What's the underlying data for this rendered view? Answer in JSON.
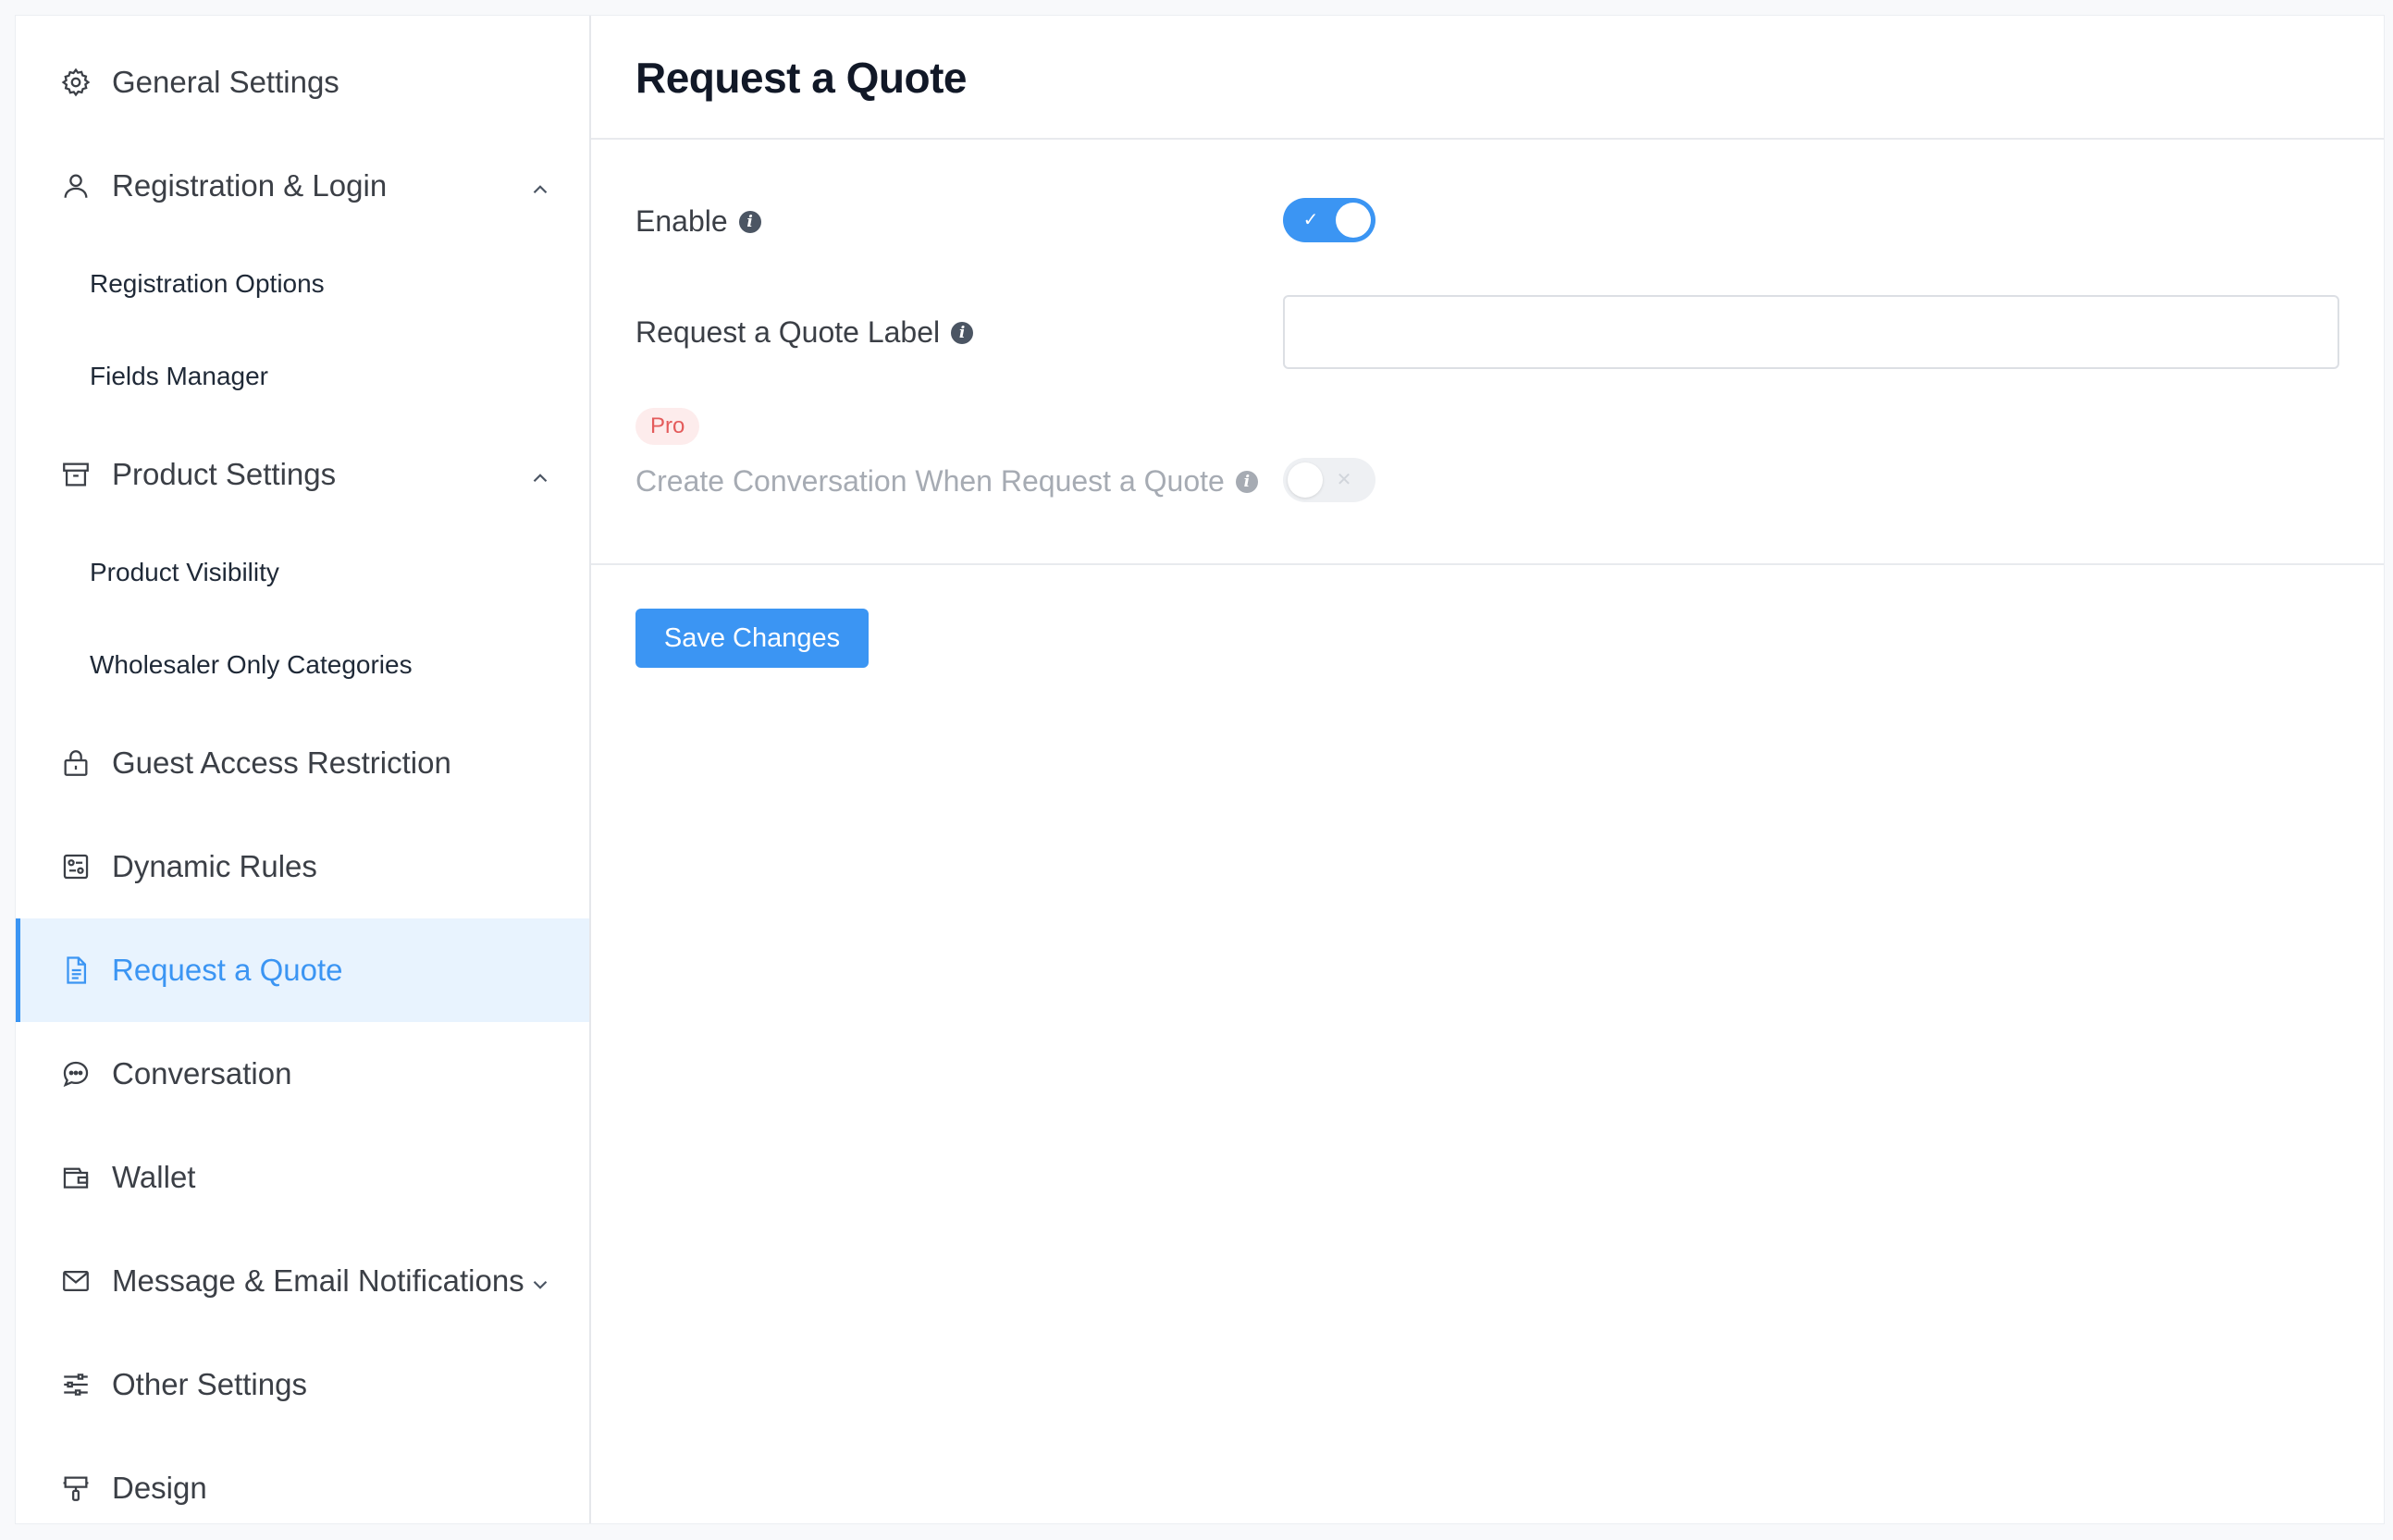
{
  "sidebar": {
    "items": [
      {
        "label": "General Settings",
        "icon": "gear-icon"
      },
      {
        "label": "Registration & Login",
        "icon": "user-icon",
        "expanded": true
      },
      {
        "label": "Registration Options"
      },
      {
        "label": "Fields Manager"
      },
      {
        "label": "Product Settings",
        "icon": "archive-box-icon",
        "expanded": true
      },
      {
        "label": "Product Visibility"
      },
      {
        "label": "Wholesaler Only Categories"
      },
      {
        "label": "Guest Access Restriction",
        "icon": "lock-icon"
      },
      {
        "label": "Dynamic Rules",
        "icon": "rules-icon"
      },
      {
        "label": "Request a Quote",
        "icon": "document-icon",
        "active": true
      },
      {
        "label": "Conversation",
        "icon": "chat-bubble-icon"
      },
      {
        "label": "Wallet",
        "icon": "wallet-icon"
      },
      {
        "label": "Message & Email Notifications",
        "icon": "envelope-icon",
        "expanded": false
      },
      {
        "label": "Other Settings",
        "icon": "sliders-icon"
      },
      {
        "label": "Design",
        "icon": "paint-brush-icon"
      }
    ]
  },
  "main": {
    "title": "Request a Quote",
    "enable": {
      "label": "Enable",
      "value": true
    },
    "quote_label": {
      "label": "Request a Quote Label",
      "value": "",
      "placeholder": ""
    },
    "pro_badge": "Pro",
    "create_conversation": {
      "label": "Create Conversation When Request a Quote",
      "value": false,
      "disabled": true
    },
    "save_label": "Save Changes"
  },
  "colors": {
    "accent": "#3b95f3",
    "active_bg": "#e8f3fe",
    "pro_bg": "#fdecec",
    "pro_text": "#e45b5b"
  }
}
